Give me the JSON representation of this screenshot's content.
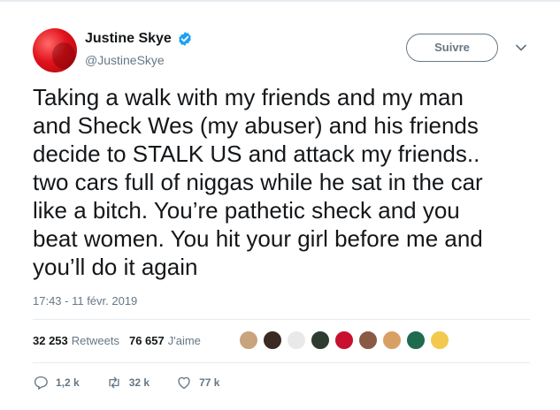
{
  "author": {
    "name": "Justine Skye",
    "handle": "@JustineSkye",
    "verified": true,
    "avatar_color": "#e1121b"
  },
  "follow_button": {
    "label": "Suivre"
  },
  "menu": {
    "icon": "chevron-down-icon"
  },
  "tweet": {
    "text": "Taking a walk with my friends and my man\nand Sheck Wes (my abuser) and his friends\ndecide to STALK US and attack my friends..\ntwo cars full of niggas while he sat in the car\nlike a bitch. You’re pathetic sheck and you\nbeat women. You hit your girl before me and\nyou’ll do it again",
    "timestamp": "17:43 - 11 févr. 2019"
  },
  "stats": {
    "retweets_count": "32 253",
    "retweets_label": "Retweets",
    "likes_count": "76 657",
    "likes_label": "J'aime"
  },
  "likers": [
    {
      "color": "#c9a27e"
    },
    {
      "color": "#3b2a22"
    },
    {
      "color": "#e9e9e9"
    },
    {
      "color": "#2f3b2f"
    },
    {
      "color": "#c8102e"
    },
    {
      "color": "#8a5a44"
    },
    {
      "color": "#d9a066"
    },
    {
      "color": "#1e6b4f"
    },
    {
      "color": "#f2c94c"
    }
  ],
  "actions": {
    "reply": {
      "count": "1,2 k",
      "icon": "reply-icon"
    },
    "retweet": {
      "count": "32 k",
      "icon": "retweet-icon"
    },
    "like": {
      "count": "77 k",
      "icon": "heart-icon"
    }
  },
  "colors": {
    "text": "#14171a",
    "secondary": "#657786",
    "verified": "#1da1f2",
    "divider": "#e6ecf0"
  }
}
